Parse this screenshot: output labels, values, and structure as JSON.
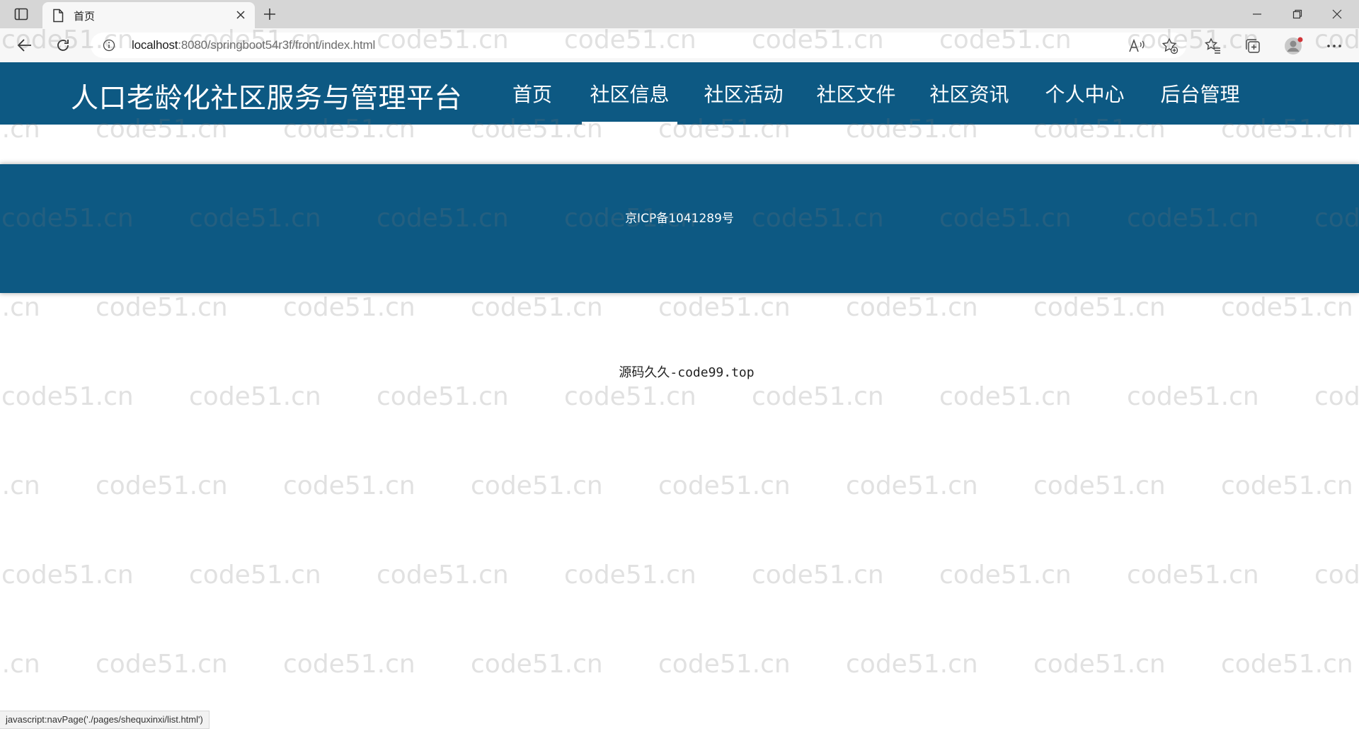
{
  "browser": {
    "tab_title": "首页",
    "url_host": "localhost",
    "url_rest": ":8080/springboot54r3f/front/index.html",
    "status_url": "javascript:navPage('./pages/shequxinxi/list.html')"
  },
  "site": {
    "title": "人口老龄化社区服务与管理平台",
    "nav": [
      {
        "label": "首页"
      },
      {
        "label": "社区信息",
        "active": true
      },
      {
        "label": "社区活动"
      },
      {
        "label": "社区文件"
      },
      {
        "label": "社区资讯"
      },
      {
        "label": "个人中心"
      },
      {
        "label": "后台管理"
      }
    ],
    "header_color": "#0d5983"
  },
  "footer": {
    "icp": "京ICP备1041289号",
    "source": "源码久久-code99.top"
  },
  "watermark": {
    "text": "code51.cn"
  }
}
